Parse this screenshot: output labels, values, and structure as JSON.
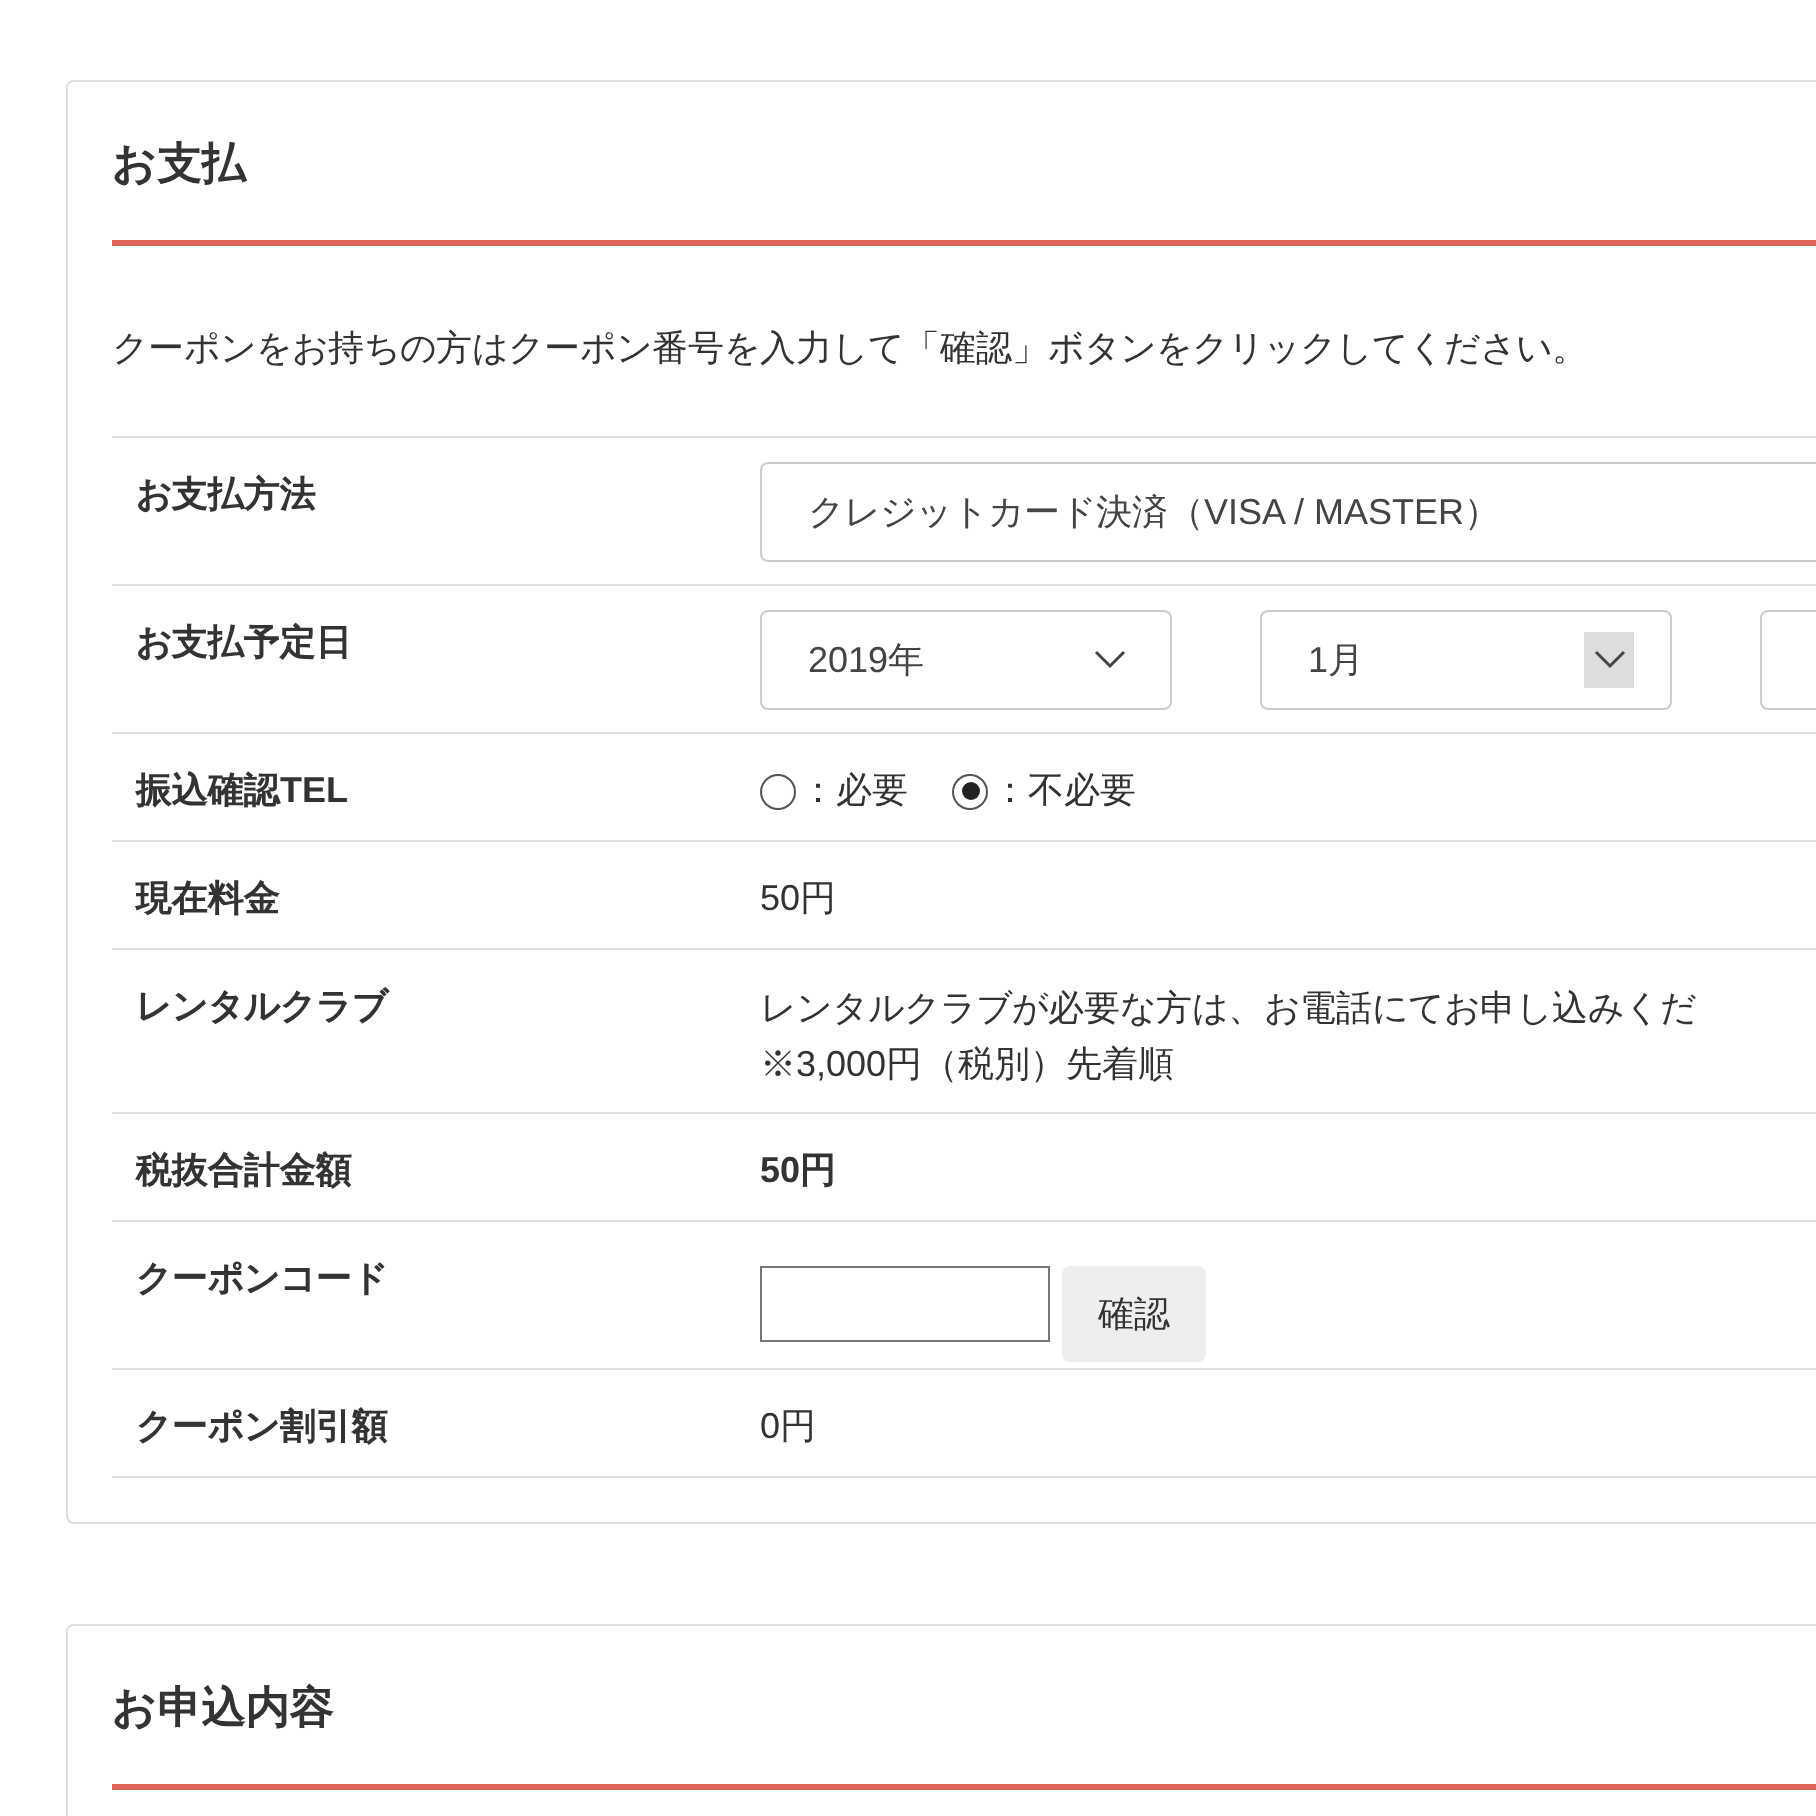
{
  "payment": {
    "title": "お支払",
    "note": "クーポンをお持ちの方はクーポン番号を入力して「確認」ボタンをクリックしてください。",
    "rows": [
      {
        "kind": "select",
        "label": "お支払方法",
        "value": "クレジットカード決済（VISA / MASTER）"
      },
      {
        "kind": "selects",
        "label": "お支払予定日",
        "selects": [
          {
            "kind": "select",
            "value": "2019年",
            "hovered": false
          },
          {
            "kind": "select",
            "value": "1月",
            "hovered": true
          },
          {
            "kind": "clipped"
          }
        ]
      },
      {
        "kind": "radio",
        "label": "振込確認TEL",
        "options": [
          {
            "label": "：必要",
            "selected": false
          },
          {
            "label": "：不必要",
            "selected": true
          }
        ]
      },
      {
        "kind": "text",
        "label": "現在料金",
        "value": "50円"
      },
      {
        "kind": "lines",
        "label": "レンタルクラブ",
        "lines": [
          "レンタルクラブが必要な方は、お電話にてお申し込みくだ",
          "※3,000円（税別）先着順"
        ]
      },
      {
        "kind": "bold",
        "label": "税抜合計金額",
        "value": "50円"
      },
      {
        "kind": "coupon",
        "label": "クーポンコード",
        "button": "確認"
      },
      {
        "kind": "text",
        "label": "クーポン割引額",
        "value": "0円"
      }
    ]
  },
  "application": {
    "title": "お申込内容"
  }
}
